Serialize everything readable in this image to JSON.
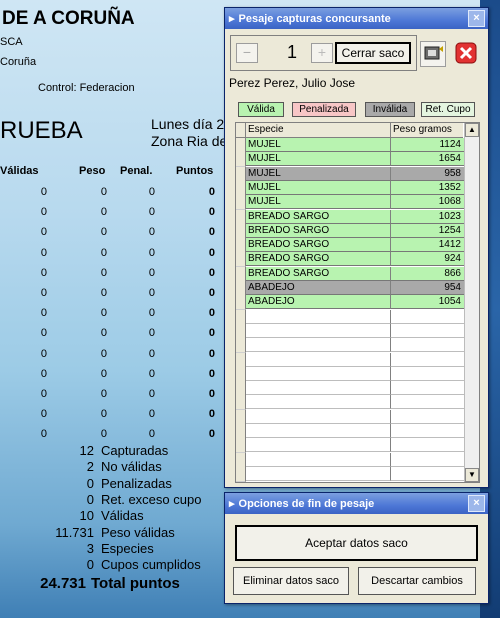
{
  "background": {
    "title": "DE A CORUÑA",
    "sub1": "SCA",
    "sub2": "Coruña",
    "control": "Control: Federacion",
    "prueba": "RUEBA",
    "date": "Lunes día 2",
    "zone": "Zona Ria de",
    "headers": [
      "Válidas",
      "Peso",
      "Penal.",
      "Puntos"
    ],
    "rows": [
      [
        "0",
        "0",
        "0",
        "0"
      ],
      [
        "0",
        "0",
        "0",
        "0"
      ],
      [
        "0",
        "0",
        "0",
        "0"
      ],
      [
        "0",
        "0",
        "0",
        "0"
      ],
      [
        "0",
        "0",
        "0",
        "0"
      ],
      [
        "0",
        "0",
        "0",
        "0"
      ],
      [
        "0",
        "0",
        "0",
        "0"
      ],
      [
        "0",
        "0",
        "0",
        "0"
      ],
      [
        "0",
        "0",
        "0",
        "0"
      ],
      [
        "0",
        "0",
        "0",
        "0"
      ],
      [
        "0",
        "0",
        "0",
        "0"
      ],
      [
        "0",
        "0",
        "0",
        "0"
      ],
      [
        "0",
        "0",
        "0",
        "0"
      ]
    ],
    "summary": [
      {
        "num": "12",
        "label": "Capturadas"
      },
      {
        "num": "2",
        "label": "No válidas"
      },
      {
        "num": "0",
        "label": "Penalizadas"
      },
      {
        "num": "0",
        "label": "Ret. exceso cupo"
      },
      {
        "num": "10",
        "label": "Válidas"
      },
      {
        "num": "11.731",
        "label": "Peso válidas"
      },
      {
        "num": "3",
        "label": "Especies"
      },
      {
        "num": "0",
        "label": "Cupos cumplidos"
      }
    ],
    "total": {
      "num": "24.731",
      "label": "Total puntos"
    }
  },
  "pesaje": {
    "title": "Pesaje capturas concursante",
    "minus": "−",
    "count": "1",
    "plus": "+",
    "cerrar_saco": "Cerrar saco",
    "competitor": "Perez Perez, Julio Jose",
    "legend": {
      "valida": "Válida",
      "penalizada": "Penalizada",
      "invalida": "Inválida",
      "ret_cupo": "Ret. Cupo"
    },
    "colors": {
      "valida": "#b8f3b0",
      "penalizada": "#f7c6c6",
      "invalida": "#a9a9a9",
      "ret_cupo": "#e4f5df"
    },
    "columns": {
      "especie": "Especie",
      "peso": "Peso gramos"
    },
    "rows": [
      {
        "especie": "MUJEL",
        "peso": "1124",
        "status": "valida"
      },
      {
        "especie": "MUJEL",
        "peso": "1654",
        "status": "valida"
      },
      {
        "especie": "MUJEL",
        "peso": "958",
        "status": "invalida"
      },
      {
        "especie": "MUJEL",
        "peso": "1352",
        "status": "valida"
      },
      {
        "especie": "MUJEL",
        "peso": "1068",
        "status": "valida"
      },
      {
        "especie": "BREADO SARGO",
        "peso": "1023",
        "status": "valida"
      },
      {
        "especie": "BREADO SARGO",
        "peso": "1254",
        "status": "valida"
      },
      {
        "especie": "BREADO SARGO",
        "peso": "1412",
        "status": "valida"
      },
      {
        "especie": "BREADO SARGO",
        "peso": "924",
        "status": "valida"
      },
      {
        "especie": "BREADO SARGO",
        "peso": "866",
        "status": "valida"
      },
      {
        "especie": "ABADEJO",
        "peso": "954",
        "status": "invalida"
      },
      {
        "especie": "ABADEJO",
        "peso": "1054",
        "status": "valida"
      }
    ]
  },
  "opciones": {
    "title": "Opciones de fin de pesaje",
    "aceptar": "Aceptar datos saco",
    "eliminar": "Eliminar datos saco",
    "descartar": "Descartar cambios"
  },
  "icons": {
    "close": "×",
    "scroll_up": "▲",
    "scroll_down": "▼"
  }
}
